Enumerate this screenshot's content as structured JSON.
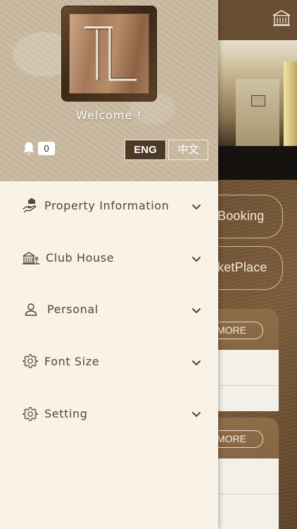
{
  "drawer": {
    "logo_letters": "TL",
    "welcome": "Welcome !",
    "notification_count": "0",
    "lang_en": "ENG",
    "lang_zh": "中文",
    "menu": [
      {
        "label": "Property Information",
        "icon": "hand-house-icon"
      },
      {
        "label": "Club House",
        "icon": "clubhouse-icon"
      },
      {
        "label": "Personal",
        "icon": "person-icon"
      },
      {
        "label": "Font Size",
        "icon": "gear-icon"
      },
      {
        "label": "Setting",
        "icon": "gear-icon"
      }
    ]
  },
  "background": {
    "buttons": [
      "Booking",
      "ketPlace"
    ],
    "more_buttons": [
      "MORE",
      "MORE"
    ]
  },
  "colors": {
    "drawer_bg": "#f8f2e7",
    "menu_text": "#5a4530",
    "lang_active_bg": "#4c3a24",
    "app_brown": "#6b5034"
  }
}
